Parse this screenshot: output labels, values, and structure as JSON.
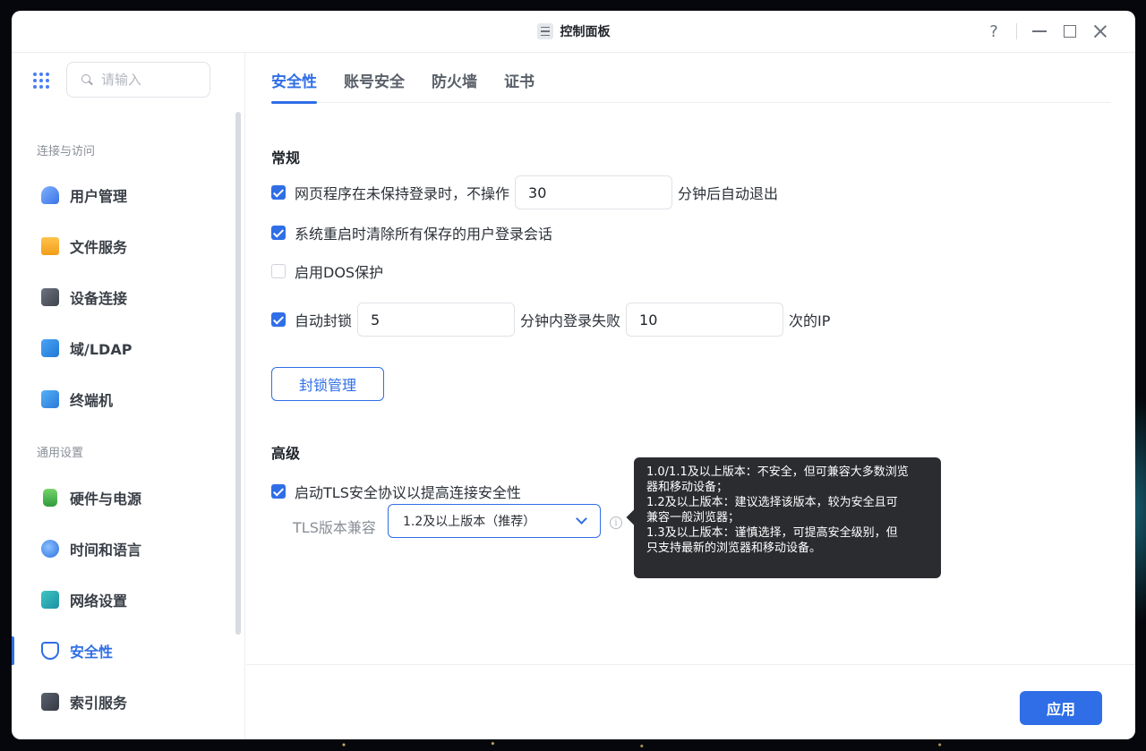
{
  "window": {
    "title": "控制面板"
  },
  "titlebar": {
    "help": "?"
  },
  "sidebar": {
    "search_placeholder": "请输入",
    "sections": [
      {
        "label": "连接与访问",
        "items": [
          {
            "label": "用户管理",
            "icon": "user-icon"
          },
          {
            "label": "文件服务",
            "icon": "folder-icon"
          },
          {
            "label": "设备连接",
            "icon": "device-icon"
          },
          {
            "label": "域/LDAP",
            "icon": "ldap-icon"
          },
          {
            "label": "终端机",
            "icon": "terminal-icon"
          }
        ]
      },
      {
        "label": "通用设置",
        "items": [
          {
            "label": "硬件与电源",
            "icon": "battery-icon"
          },
          {
            "label": "时间和语言",
            "icon": "globe-icon"
          },
          {
            "label": "网络设置",
            "icon": "network-icon"
          },
          {
            "label": "安全性",
            "icon": "shield-icon",
            "active": true
          },
          {
            "label": "索引服务",
            "icon": "index-icon"
          }
        ]
      }
    ]
  },
  "tabs": [
    {
      "label": "安全性",
      "active": true
    },
    {
      "label": "账号安全"
    },
    {
      "label": "防火墙"
    },
    {
      "label": "证书"
    }
  ],
  "general": {
    "title": "常规",
    "logout": {
      "checked": true,
      "prefix": "网页程序在未保持登录时，不操作",
      "value": "30",
      "suffix": "分钟后自动退出"
    },
    "clear_sessions": {
      "checked": true,
      "label": "系统重启时清除所有保存的用户登录会话"
    },
    "dos": {
      "checked": false,
      "label": "启用DOS保护"
    },
    "autoblock": {
      "checked": true,
      "prefix": "自动封锁",
      "minutes": "5",
      "middle": "分钟内登录失败",
      "count": "10",
      "suffix": "次的IP"
    },
    "block_button": "封锁管理"
  },
  "advanced": {
    "title": "高级",
    "tls": {
      "checked": true,
      "label": "启动TLS安全协议以提高连接安全性"
    },
    "tls_compat_label": "TLS版本兼容",
    "tls_selected": "1.2及以上版本（推荐）",
    "tooltip": [
      "1.0/1.1及以上版本：不安全，但可兼容大多数浏览",
      "器和移动设备；",
      "1.2及以上版本：建议选择该版本，较为安全且可",
      "兼容一般浏览器；",
      "1.3及以上版本：谨慎选择，可提高安全级别，但",
      "只支持最新的浏览器和移动设备。"
    ]
  },
  "footer": {
    "apply": "应用"
  },
  "colors": {
    "accent": "#2f6ee6",
    "tooltip_bg": "#2a2c30"
  }
}
